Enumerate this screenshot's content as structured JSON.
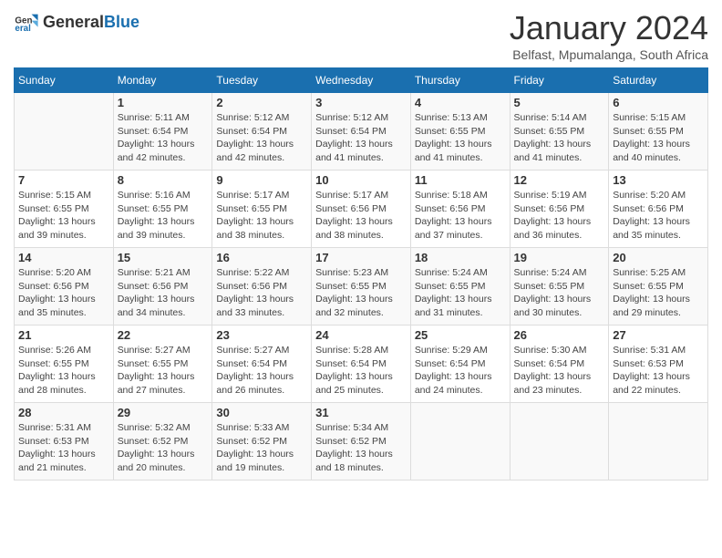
{
  "header": {
    "logo_general": "General",
    "logo_blue": "Blue",
    "month_title": "January 2024",
    "subtitle": "Belfast, Mpumalanga, South Africa"
  },
  "days_of_week": [
    "Sunday",
    "Monday",
    "Tuesday",
    "Wednesday",
    "Thursday",
    "Friday",
    "Saturday"
  ],
  "weeks": [
    [
      {
        "day": "",
        "info": ""
      },
      {
        "day": "1",
        "info": "Sunrise: 5:11 AM\nSunset: 6:54 PM\nDaylight: 13 hours\nand 42 minutes."
      },
      {
        "day": "2",
        "info": "Sunrise: 5:12 AM\nSunset: 6:54 PM\nDaylight: 13 hours\nand 42 minutes."
      },
      {
        "day": "3",
        "info": "Sunrise: 5:12 AM\nSunset: 6:54 PM\nDaylight: 13 hours\nand 41 minutes."
      },
      {
        "day": "4",
        "info": "Sunrise: 5:13 AM\nSunset: 6:55 PM\nDaylight: 13 hours\nand 41 minutes."
      },
      {
        "day": "5",
        "info": "Sunrise: 5:14 AM\nSunset: 6:55 PM\nDaylight: 13 hours\nand 41 minutes."
      },
      {
        "day": "6",
        "info": "Sunrise: 5:15 AM\nSunset: 6:55 PM\nDaylight: 13 hours\nand 40 minutes."
      }
    ],
    [
      {
        "day": "7",
        "info": "Sunrise: 5:15 AM\nSunset: 6:55 PM\nDaylight: 13 hours\nand 39 minutes."
      },
      {
        "day": "8",
        "info": "Sunrise: 5:16 AM\nSunset: 6:55 PM\nDaylight: 13 hours\nand 39 minutes."
      },
      {
        "day": "9",
        "info": "Sunrise: 5:17 AM\nSunset: 6:55 PM\nDaylight: 13 hours\nand 38 minutes."
      },
      {
        "day": "10",
        "info": "Sunrise: 5:17 AM\nSunset: 6:56 PM\nDaylight: 13 hours\nand 38 minutes."
      },
      {
        "day": "11",
        "info": "Sunrise: 5:18 AM\nSunset: 6:56 PM\nDaylight: 13 hours\nand 37 minutes."
      },
      {
        "day": "12",
        "info": "Sunrise: 5:19 AM\nSunset: 6:56 PM\nDaylight: 13 hours\nand 36 minutes."
      },
      {
        "day": "13",
        "info": "Sunrise: 5:20 AM\nSunset: 6:56 PM\nDaylight: 13 hours\nand 35 minutes."
      }
    ],
    [
      {
        "day": "14",
        "info": "Sunrise: 5:20 AM\nSunset: 6:56 PM\nDaylight: 13 hours\nand 35 minutes."
      },
      {
        "day": "15",
        "info": "Sunrise: 5:21 AM\nSunset: 6:56 PM\nDaylight: 13 hours\nand 34 minutes."
      },
      {
        "day": "16",
        "info": "Sunrise: 5:22 AM\nSunset: 6:56 PM\nDaylight: 13 hours\nand 33 minutes."
      },
      {
        "day": "17",
        "info": "Sunrise: 5:23 AM\nSunset: 6:55 PM\nDaylight: 13 hours\nand 32 minutes."
      },
      {
        "day": "18",
        "info": "Sunrise: 5:24 AM\nSunset: 6:55 PM\nDaylight: 13 hours\nand 31 minutes."
      },
      {
        "day": "19",
        "info": "Sunrise: 5:24 AM\nSunset: 6:55 PM\nDaylight: 13 hours\nand 30 minutes."
      },
      {
        "day": "20",
        "info": "Sunrise: 5:25 AM\nSunset: 6:55 PM\nDaylight: 13 hours\nand 29 minutes."
      }
    ],
    [
      {
        "day": "21",
        "info": "Sunrise: 5:26 AM\nSunset: 6:55 PM\nDaylight: 13 hours\nand 28 minutes."
      },
      {
        "day": "22",
        "info": "Sunrise: 5:27 AM\nSunset: 6:55 PM\nDaylight: 13 hours\nand 27 minutes."
      },
      {
        "day": "23",
        "info": "Sunrise: 5:27 AM\nSunset: 6:54 PM\nDaylight: 13 hours\nand 26 minutes."
      },
      {
        "day": "24",
        "info": "Sunrise: 5:28 AM\nSunset: 6:54 PM\nDaylight: 13 hours\nand 25 minutes."
      },
      {
        "day": "25",
        "info": "Sunrise: 5:29 AM\nSunset: 6:54 PM\nDaylight: 13 hours\nand 24 minutes."
      },
      {
        "day": "26",
        "info": "Sunrise: 5:30 AM\nSunset: 6:54 PM\nDaylight: 13 hours\nand 23 minutes."
      },
      {
        "day": "27",
        "info": "Sunrise: 5:31 AM\nSunset: 6:53 PM\nDaylight: 13 hours\nand 22 minutes."
      }
    ],
    [
      {
        "day": "28",
        "info": "Sunrise: 5:31 AM\nSunset: 6:53 PM\nDaylight: 13 hours\nand 21 minutes."
      },
      {
        "day": "29",
        "info": "Sunrise: 5:32 AM\nSunset: 6:52 PM\nDaylight: 13 hours\nand 20 minutes."
      },
      {
        "day": "30",
        "info": "Sunrise: 5:33 AM\nSunset: 6:52 PM\nDaylight: 13 hours\nand 19 minutes."
      },
      {
        "day": "31",
        "info": "Sunrise: 5:34 AM\nSunset: 6:52 PM\nDaylight: 13 hours\nand 18 minutes."
      },
      {
        "day": "",
        "info": ""
      },
      {
        "day": "",
        "info": ""
      },
      {
        "day": "",
        "info": ""
      }
    ]
  ]
}
